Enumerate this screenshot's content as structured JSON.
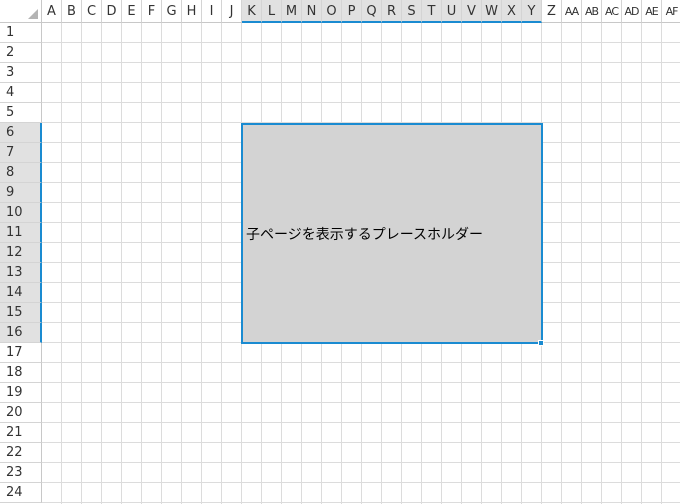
{
  "columns": [
    "A",
    "B",
    "C",
    "D",
    "E",
    "F",
    "G",
    "H",
    "I",
    "J",
    "K",
    "L",
    "M",
    "N",
    "O",
    "P",
    "Q",
    "R",
    "S",
    "T",
    "U",
    "V",
    "W",
    "X",
    "Y",
    "Z",
    "AA",
    "AB",
    "AC",
    "AD",
    "AE",
    "AF"
  ],
  "rows": [
    "1",
    "2",
    "3",
    "4",
    "5",
    "6",
    "7",
    "8",
    "9",
    "10",
    "11",
    "12",
    "13",
    "14",
    "15",
    "16",
    "17",
    "18",
    "19",
    "20",
    "21",
    "22",
    "23",
    "24"
  ],
  "selection": {
    "columns": [
      "K",
      "L",
      "M",
      "N",
      "O",
      "P",
      "Q",
      "R",
      "S",
      "T",
      "U",
      "V",
      "W",
      "X",
      "Y"
    ],
    "rows": [
      "6",
      "7",
      "8",
      "9",
      "10",
      "11",
      "12",
      "13",
      "14",
      "15",
      "16"
    ]
  },
  "placeholder": {
    "text": "子ページを表示するプレースホルダー"
  },
  "colors": {
    "selection_accent": "#1a8bd1",
    "placeholder_fill": "#d3d3d3",
    "header_selected": "#e1e1e1"
  }
}
